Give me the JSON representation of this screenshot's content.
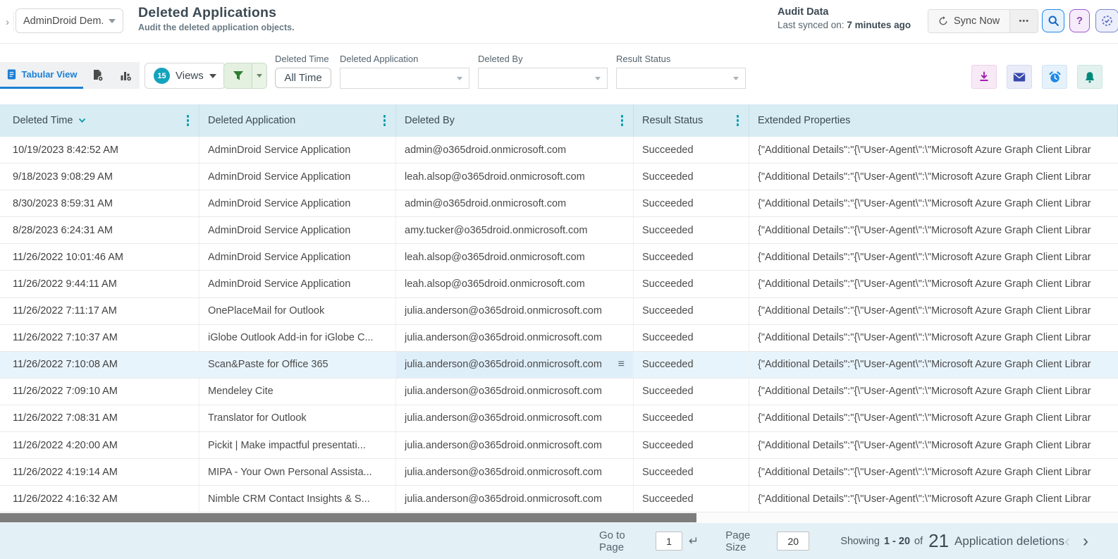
{
  "topbar": {
    "nav_chevron": "›",
    "tenant_selector": "AdminDroid Dem...",
    "title": "Deleted Applications",
    "subtitle": "Audit the deleted application objects.",
    "audit_data_heading": "Audit Data",
    "last_synced_label": "Last synced on:",
    "last_synced_value": "7 minutes ago",
    "sync_now": "Sync Now",
    "more_options": "•••",
    "help_label": "?"
  },
  "toolbar": {
    "tabular_view_tab": "Tabular View",
    "views_badge": "15",
    "views_label": "Views",
    "filters": {
      "deleted_time": {
        "label": "Deleted Time",
        "value": "All Time"
      },
      "deleted_application": {
        "label": "Deleted Application",
        "value": ""
      },
      "deleted_by": {
        "label": "Deleted By",
        "value": ""
      },
      "result_status": {
        "label": "Result Status",
        "value": ""
      }
    }
  },
  "table": {
    "columns": [
      "Deleted Time",
      "Deleted Application",
      "Deleted By",
      "Result Status",
      "Extended Properties"
    ],
    "sort": {
      "column": "Deleted Time",
      "direction": "desc"
    },
    "highlighted_row_index": 8,
    "row_menu_icon": "≡",
    "rows": [
      {
        "time": "10/19/2023 8:42:52 AM",
        "app": "AdminDroid Service Application",
        "by": "admin@o365droid.onmicrosoft.com",
        "status": "Succeeded",
        "props": "{\"Additional Details\":\"{\\\"User-Agent\\\":\\\"Microsoft Azure Graph Client Librar"
      },
      {
        "time": "9/18/2023 9:08:29 AM",
        "app": "AdminDroid Service Application",
        "by": "leah.alsop@o365droid.onmicrosoft.com",
        "status": "Succeeded",
        "props": "{\"Additional Details\":\"{\\\"User-Agent\\\":\\\"Microsoft Azure Graph Client Librar"
      },
      {
        "time": "8/30/2023 8:59:31 AM",
        "app": "AdminDroid Service Application",
        "by": "admin@o365droid.onmicrosoft.com",
        "status": "Succeeded",
        "props": "{\"Additional Details\":\"{\\\"User-Agent\\\":\\\"Microsoft Azure Graph Client Librar"
      },
      {
        "time": "8/28/2023 6:24:31 AM",
        "app": "AdminDroid Service Application",
        "by": "amy.tucker@o365droid.onmicrosoft.com",
        "status": "Succeeded",
        "props": "{\"Additional Details\":\"{\\\"User-Agent\\\":\\\"Microsoft Azure Graph Client Librar"
      },
      {
        "time": "11/26/2022 10:01:46 AM",
        "app": "AdminDroid Service Application",
        "by": "leah.alsop@o365droid.onmicrosoft.com",
        "status": "Succeeded",
        "props": "{\"Additional Details\":\"{\\\"User-Agent\\\":\\\"Microsoft Azure Graph Client Librar"
      },
      {
        "time": "11/26/2022 9:44:11 AM",
        "app": "AdminDroid Service Application",
        "by": "leah.alsop@o365droid.onmicrosoft.com",
        "status": "Succeeded",
        "props": "{\"Additional Details\":\"{\\\"User-Agent\\\":\\\"Microsoft Azure Graph Client Librar"
      },
      {
        "time": "11/26/2022 7:11:17 AM",
        "app": "OnePlaceMail for Outlook",
        "by": "julia.anderson@o365droid.onmicrosoft.com",
        "status": "Succeeded",
        "props": "{\"Additional Details\":\"{\\\"User-Agent\\\":\\\"Microsoft Azure Graph Client Librar"
      },
      {
        "time": "11/26/2022 7:10:37 AM",
        "app": "iGlobe Outlook Add-in for iGlobe C...",
        "by": "julia.anderson@o365droid.onmicrosoft.com",
        "status": "Succeeded",
        "props": "{\"Additional Details\":\"{\\\"User-Agent\\\":\\\"Microsoft Azure Graph Client Librar"
      },
      {
        "time": "11/26/2022 7:10:08 AM",
        "app": "Scan&Paste for Office 365",
        "by": "julia.anderson@o365droid.onmicrosoft.com",
        "status": "Succeeded",
        "props": "{\"Additional Details\":\"{\\\"User-Agent\\\":\\\"Microsoft Azure Graph Client Librar"
      },
      {
        "time": "11/26/2022 7:09:10 AM",
        "app": "Mendeley Cite",
        "by": "julia.anderson@o365droid.onmicrosoft.com",
        "status": "Succeeded",
        "props": "{\"Additional Details\":\"{\\\"User-Agent\\\":\\\"Microsoft Azure Graph Client Librar"
      },
      {
        "time": "11/26/2022 7:08:31 AM",
        "app": "Translator for Outlook",
        "by": "julia.anderson@o365droid.onmicrosoft.com",
        "status": "Succeeded",
        "props": "{\"Additional Details\":\"{\\\"User-Agent\\\":\\\"Microsoft Azure Graph Client Librar"
      },
      {
        "time": "11/26/2022 4:20:00 AM",
        "app": "Pickit | Make impactful presentati...",
        "by": "julia.anderson@o365droid.onmicrosoft.com",
        "status": "Succeeded",
        "props": "{\"Additional Details\":\"{\\\"User-Agent\\\":\\\"Microsoft Azure Graph Client Librar"
      },
      {
        "time": "11/26/2022 4:19:14 AM",
        "app": "MIPA - Your Own Personal Assista...",
        "by": "julia.anderson@o365droid.onmicrosoft.com",
        "status": "Succeeded",
        "props": "{\"Additional Details\":\"{\\\"User-Agent\\\":\\\"Microsoft Azure Graph Client Librar"
      },
      {
        "time": "11/26/2022 4:16:32 AM",
        "app": "Nimble CRM Contact Insights & S...",
        "by": "julia.anderson@o365droid.onmicrosoft.com",
        "status": "Succeeded",
        "props": "{\"Additional Details\":\"{\\\"User-Agent\\\":\\\"Microsoft Azure Graph Client Librar"
      }
    ]
  },
  "footer": {
    "go_to_page_label": "Go to Page",
    "go_to_page_value": "1",
    "return_icon": "↵",
    "page_size_label": "Page Size",
    "page_size_value": "20",
    "showing_label": "Showing",
    "showing_range": "1 - 20",
    "of_label": "of",
    "total_count": "21",
    "showing_suffix": "Application deletions",
    "prev_arrow": "‹",
    "next_arrow": "›"
  },
  "colors": {
    "accent_teal": "#14a3bd",
    "tab_active_blue": "#1c7fd6",
    "table_header_bg": "#d8ecf3",
    "footer_bg": "#e3f0f6",
    "highlight_row_bg": "#e8f4fb",
    "filter_green": "#2e7d32",
    "download_icon": "#a21caf",
    "mail_icon": "#3949ab",
    "alarm_icon": "#1e88e5",
    "bell_icon": "#00897b",
    "search_icon": "#1565c0",
    "help_icon": "#8e44ad"
  }
}
